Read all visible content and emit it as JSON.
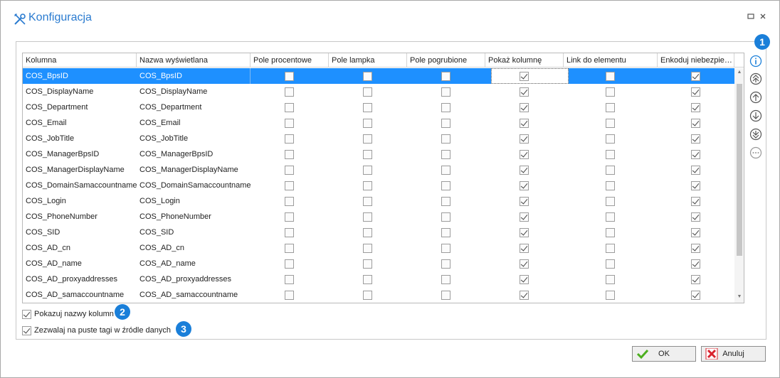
{
  "window": {
    "title": "Konfiguracja"
  },
  "grid": {
    "columns": [
      "Kolumna",
      "Nazwa wyświetlana",
      "Pole procentowe",
      "Pole lampka",
      "Pole pogrubione",
      "Pokaż kolumnę",
      "Link do elementu",
      "Enkoduj niebezpie…"
    ],
    "selected_row": 0,
    "rows": [
      {
        "kolumna": "COS_BpsID",
        "nazwa": "COS_BpsID",
        "procent": false,
        "lampka": false,
        "pogrubione": false,
        "pokaz": true,
        "link": false,
        "enkoduj": true
      },
      {
        "kolumna": "COS_DisplayName",
        "nazwa": "COS_DisplayName",
        "procent": false,
        "lampka": false,
        "pogrubione": false,
        "pokaz": true,
        "link": false,
        "enkoduj": true
      },
      {
        "kolumna": "COS_Department",
        "nazwa": "COS_Department",
        "procent": false,
        "lampka": false,
        "pogrubione": false,
        "pokaz": true,
        "link": false,
        "enkoduj": true
      },
      {
        "kolumna": "COS_Email",
        "nazwa": "COS_Email",
        "procent": false,
        "lampka": false,
        "pogrubione": false,
        "pokaz": true,
        "link": false,
        "enkoduj": true
      },
      {
        "kolumna": "COS_JobTitle",
        "nazwa": "COS_JobTitle",
        "procent": false,
        "lampka": false,
        "pogrubione": false,
        "pokaz": true,
        "link": false,
        "enkoduj": true
      },
      {
        "kolumna": "COS_ManagerBpsID",
        "nazwa": "COS_ManagerBpsID",
        "procent": false,
        "lampka": false,
        "pogrubione": false,
        "pokaz": true,
        "link": false,
        "enkoduj": true
      },
      {
        "kolumna": "COS_ManagerDisplayName",
        "nazwa": "COS_ManagerDisplayName",
        "procent": false,
        "lampka": false,
        "pogrubione": false,
        "pokaz": true,
        "link": false,
        "enkoduj": true
      },
      {
        "kolumna": "COS_DomainSamaccountname",
        "nazwa": "COS_DomainSamaccountname",
        "procent": false,
        "lampka": false,
        "pogrubione": false,
        "pokaz": true,
        "link": false,
        "enkoduj": true
      },
      {
        "kolumna": "COS_Login",
        "nazwa": "COS_Login",
        "procent": false,
        "lampka": false,
        "pogrubione": false,
        "pokaz": true,
        "link": false,
        "enkoduj": true
      },
      {
        "kolumna": "COS_PhoneNumber",
        "nazwa": "COS_PhoneNumber",
        "procent": false,
        "lampka": false,
        "pogrubione": false,
        "pokaz": true,
        "link": false,
        "enkoduj": true
      },
      {
        "kolumna": "COS_SID",
        "nazwa": "COS_SID",
        "procent": false,
        "lampka": false,
        "pogrubione": false,
        "pokaz": true,
        "link": false,
        "enkoduj": true
      },
      {
        "kolumna": "COS_AD_cn",
        "nazwa": "COS_AD_cn",
        "procent": false,
        "lampka": false,
        "pogrubione": false,
        "pokaz": true,
        "link": false,
        "enkoduj": true
      },
      {
        "kolumna": "COS_AD_name",
        "nazwa": "COS_AD_name",
        "procent": false,
        "lampka": false,
        "pogrubione": false,
        "pokaz": true,
        "link": false,
        "enkoduj": true
      },
      {
        "kolumna": "COS_AD_proxyaddresses",
        "nazwa": "COS_AD_proxyaddresses",
        "procent": false,
        "lampka": false,
        "pogrubione": false,
        "pokaz": true,
        "link": false,
        "enkoduj": true
      },
      {
        "kolumna": "COS_AD_samaccountname",
        "nazwa": "COS_AD_samaccountname",
        "procent": false,
        "lampka": false,
        "pogrubione": false,
        "pokaz": true,
        "link": false,
        "enkoduj": true
      }
    ]
  },
  "side_toolbar": [
    "info-icon",
    "move-top-icon",
    "move-up-icon",
    "move-down-icon",
    "move-bottom-icon",
    "more-icon"
  ],
  "options": {
    "show_column_names": {
      "label": "Pokazuj nazwy kolumn",
      "checked": true
    },
    "allow_empty_tags": {
      "label": "Zezwalaj na puste tagi w źródle danych",
      "checked": true
    }
  },
  "badges": [
    "1",
    "2",
    "3"
  ],
  "buttons": {
    "ok": "OK",
    "cancel": "Anuluj"
  },
  "colors": {
    "accent": "#1a7fd9",
    "selected_row": "#1e90ff",
    "title": "#2a7bd0",
    "ok_icon": "#4caf1f",
    "cancel_icon": "#d9232e"
  }
}
